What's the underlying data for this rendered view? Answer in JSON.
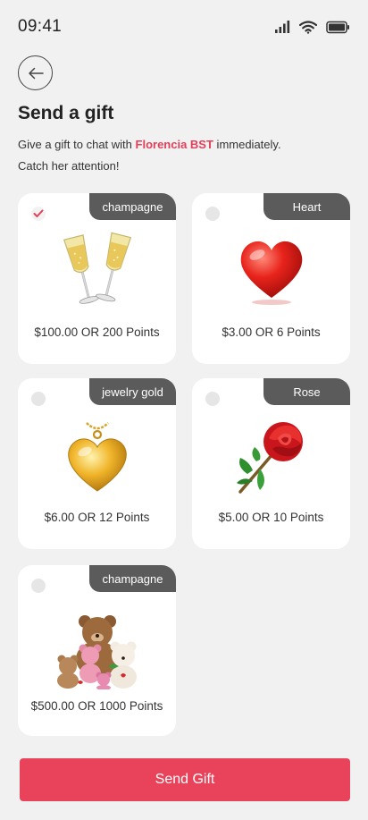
{
  "status_bar": {
    "time": "09:41",
    "icons": [
      "signal-icon",
      "wifi-icon",
      "battery-icon"
    ]
  },
  "header": {
    "back_icon": "arrow-left-icon",
    "title": "Send a gift",
    "subtitle_prefix": "Give a gift to chat with ",
    "recipient_name": "Florencia BST",
    "subtitle_suffix": " immediately.",
    "subtitle_line2": "Catch her attention!"
  },
  "gifts": [
    {
      "tag": "champagne",
      "price": "$100.00 OR 200 Points",
      "selected": true,
      "icon": "champagne-glasses-icon"
    },
    {
      "tag": "Heart",
      "price": "$3.00 OR 6 Points",
      "selected": false,
      "icon": "heart-icon"
    },
    {
      "tag": "jewelry gold",
      "price": "$6.00 OR 12 Points",
      "selected": false,
      "icon": "gold-heart-pendant-icon"
    },
    {
      "tag": "Rose",
      "price": "$5.00 OR 10 Points",
      "selected": false,
      "icon": "rose-icon"
    },
    {
      "tag": "champagne",
      "price": "$500.00 OR 1000 Points",
      "selected": false,
      "icon": "teddy-bears-icon"
    }
  ],
  "footer": {
    "send_button_label": "Send Gift"
  },
  "colors": {
    "accent": "#e8435a",
    "tag_background": "#5b5b5b",
    "page_background": "#f1f1f1",
    "card_background": "#ffffff"
  }
}
